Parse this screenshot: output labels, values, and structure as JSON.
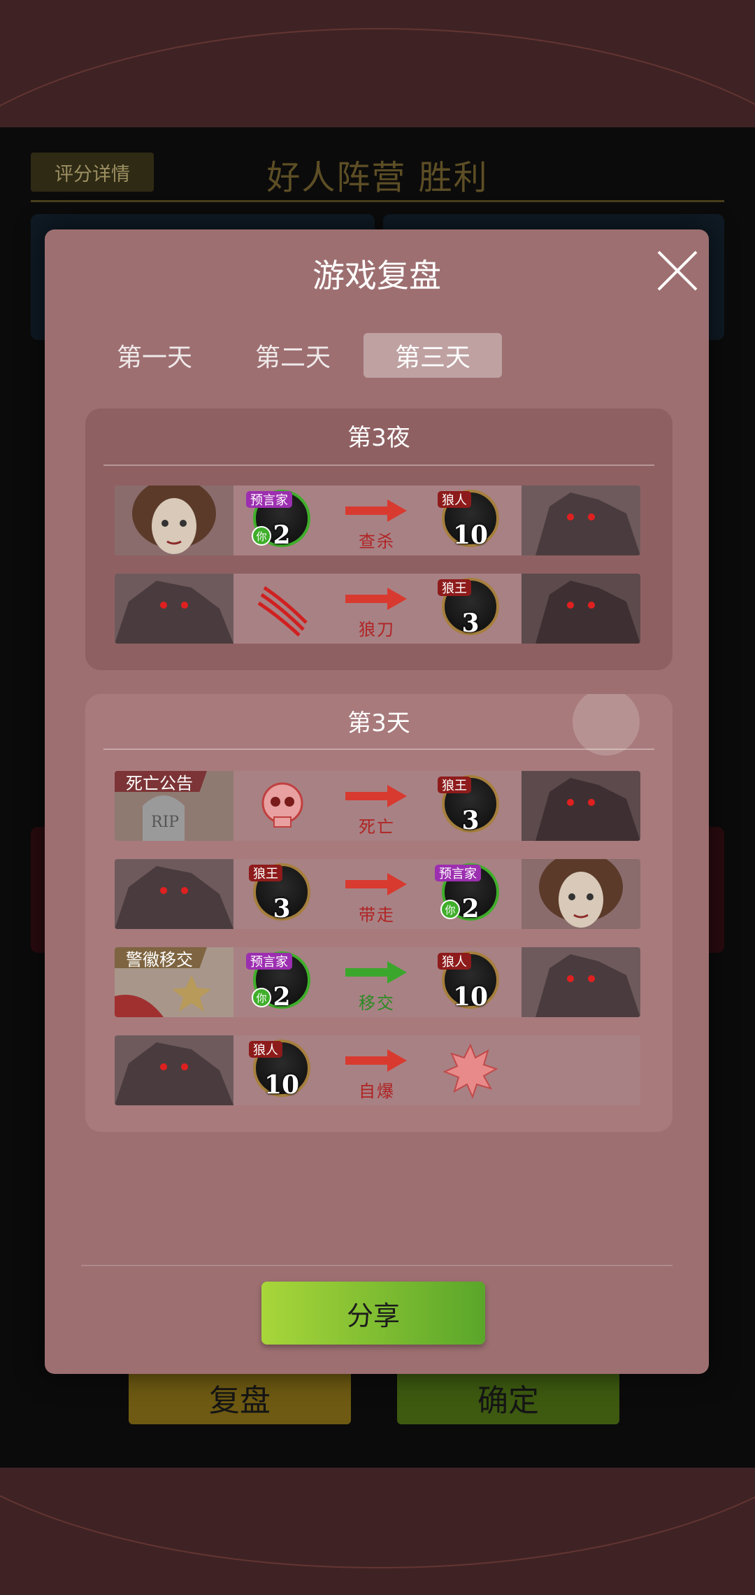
{
  "background": {
    "rating_button": "评分详情",
    "result_title": "好人阵营  胜利",
    "replay_button": "复盘",
    "confirm_button": "确定"
  },
  "modal": {
    "title": "游戏复盘",
    "tabs": [
      {
        "label": "第一天",
        "active": false
      },
      {
        "label": "第二天",
        "active": false
      },
      {
        "label": "第三天",
        "active": true
      }
    ],
    "sections": [
      {
        "title": "第3夜",
        "rows": [
          {
            "left": {
              "portrait": "seer-portrait",
              "role": "预言家",
              "number": "2",
              "you": true
            },
            "action": "查杀",
            "arrow": "red",
            "right": {
              "role": "狼人",
              "number": "10",
              "portrait": "wolf-portrait"
            }
          },
          {
            "left": {
              "portrait": "wolf-portrait",
              "icon": "claw-slash-icon"
            },
            "action": "狼刀",
            "arrow": "red",
            "right": {
              "role": "狼王",
              "number": "3",
              "portrait": "wolf-portrait"
            }
          }
        ]
      },
      {
        "title": "第3天",
        "rows": [
          {
            "ribbon": "死亡公告",
            "left": {
              "portrait": "tombstone-illustration",
              "icon": "skull-icon"
            },
            "action": "死亡",
            "arrow": "red",
            "right": {
              "role": "狼王",
              "number": "3",
              "portrait": "wolf-portrait"
            }
          },
          {
            "left": {
              "portrait": "wolf-portrait",
              "role": "狼王",
              "number": "3"
            },
            "action": "带走",
            "arrow": "red",
            "right": {
              "role": "预言家",
              "number": "2",
              "you": true,
              "portrait": "seer-portrait"
            }
          },
          {
            "ribbon": "警徽移交",
            "left": {
              "portrait": "badge-illustration",
              "role": "预言家",
              "number": "2",
              "you": true
            },
            "action": "移交",
            "arrow": "green",
            "right": {
              "role": "狼人",
              "number": "10",
              "portrait": "wolf-portrait"
            }
          },
          {
            "left": {
              "portrait": "wolf-portrait",
              "role": "狼人",
              "number": "10"
            },
            "action": "自爆",
            "arrow": "red",
            "right": {
              "icon": "explosion-icon"
            }
          }
        ]
      }
    ],
    "you_label": "你",
    "share_button": "分享"
  }
}
